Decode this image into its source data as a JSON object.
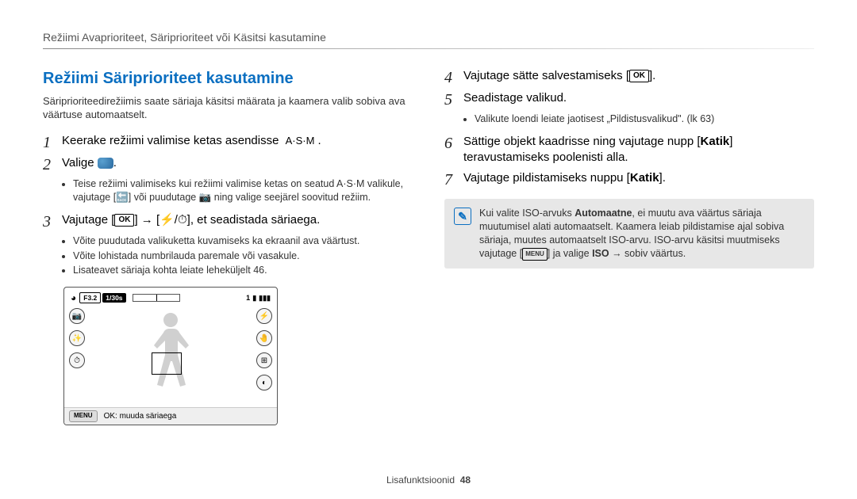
{
  "breadcrumb": "Režiimi Avaprioriteet, Säriprioriteet või Käsitsi kasutamine",
  "heading": "Režiimi Säriprioriteet kasutamine",
  "intro": "Säriprioriteedirežiimis saate säriaja käsitsi määrata ja kaamera valib sobiva ava väärtuse automaatselt.",
  "steps": {
    "s1": "Keerake režiimi valimise ketas asendisse",
    "s1_suffix": ".",
    "s2": "Valige",
    "s2_suffix": ".",
    "s2_bullets": [
      "Teise režiimi valimiseks kui režiimi valimise ketas on seatud A·S·M valikule, vajutage [🔙] või puudutage 📷 ning valige seejärel soovitud režiim."
    ],
    "s3": "Vajutage [",
    "s3_keys_mid": "] → [",
    "s3_end": "], et seadistada säriaega.",
    "s3_bullets": [
      "Võite puudutada valikuketta kuvamiseks ka ekraanil ava väärtust.",
      "Võite lohistada numbrilauda paremale või vasakule.",
      "Lisateavet säriaja kohta leiate leheküljelt 46."
    ],
    "s4": "Vajutage sätte salvestamiseks [",
    "s4_end": "].",
    "s5": "Seadistage valikud.",
    "s5_bullets": [
      "Valikute loendi leiate jaotisest „Pildistusvalikud\". (lk 63)"
    ],
    "s6_a": "Sättige objekt kaadrisse ning vajutage nupp [",
    "s6_btn": "Katik",
    "s6_b": "] teravustamiseks poolenisti alla.",
    "s7_a": "Vajutage pildistamiseks nuppu [",
    "s7_btn": "Katik",
    "s7_b": "]."
  },
  "note": {
    "text_a": "Kui valite ISO-arvuks ",
    "bold": "Automaatne",
    "text_b": ", ei muutu ava väärtus säriaja muutumisel alati automaatselt. Kaamera leiab pildistamise ajal sobiva säriaja, muutes automaatselt ISO-arvu. ISO-arvu käsitsi muutmiseks vajutage [",
    "text_c": "] ja valige ",
    "bold2": "ISO",
    "text_d": " → sobiv väärtus."
  },
  "screen": {
    "f_value": "F3.2",
    "shutter": "1/30s",
    "count": "1",
    "quality": "▮",
    "batt": "▮▮▮",
    "bottom_label": "OK: muuda säriaega"
  },
  "keys": {
    "ok": "OK",
    "menu": "MENU",
    "asm": "A·S·M",
    "flash_timer": "⚡/⏱"
  },
  "footer": {
    "label": "Lisafunktsioonid",
    "page": "48"
  }
}
